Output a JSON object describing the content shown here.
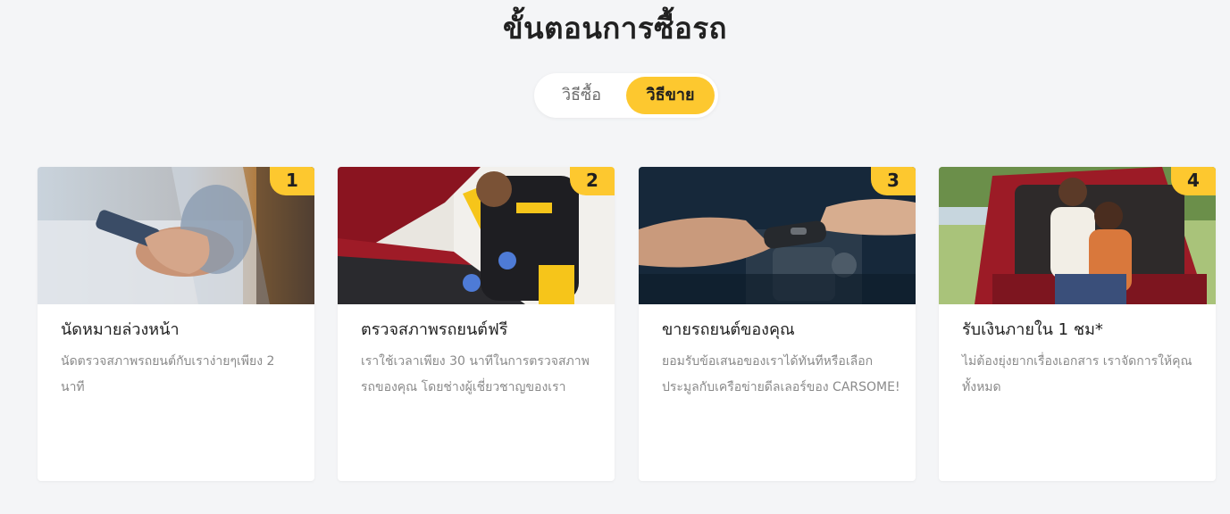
{
  "section": {
    "title": "ขั้นตอนการซื้อรถ"
  },
  "toggle": {
    "buy_label": "วิธีซื้อ",
    "sell_label": "วิธีขาย",
    "active": "sell"
  },
  "steps": [
    {
      "number": "1",
      "title": "นัดหมายล่วงหน้า",
      "description": "นัดตรวจสภาพรถยนต์กับเราง่ายๆเพียง 2 นาที"
    },
    {
      "number": "2",
      "title": "ตรวจสภาพรถยนต์ฟรี",
      "description": "เราใช้เวลาเพียง 30 นาทีในการตรวจสภาพรถของคุณ โดยช่างผู้เชี่ยวชาญของเรา"
    },
    {
      "number": "3",
      "title": "ขายรถยนต์ของคุณ",
      "description": "ยอมรับข้อเสนอของเราได้ทันทีหรือเลือกประมูลกับเครือข่ายดีลเลอร์ของ CARSOME!"
    },
    {
      "number": "4",
      "title": "รับเงินภายใน 1 ชม*",
      "description": "ไม่ต้องยุ่งยากเรื่องเอกสาร เราจัดการให้คุณทั้งหมด"
    }
  ],
  "colors": {
    "accent": "#fdc82f",
    "background": "#f4f5f7",
    "card": "#ffffff",
    "title_text": "#1f1f1f",
    "body_text": "#8a8a8a"
  }
}
